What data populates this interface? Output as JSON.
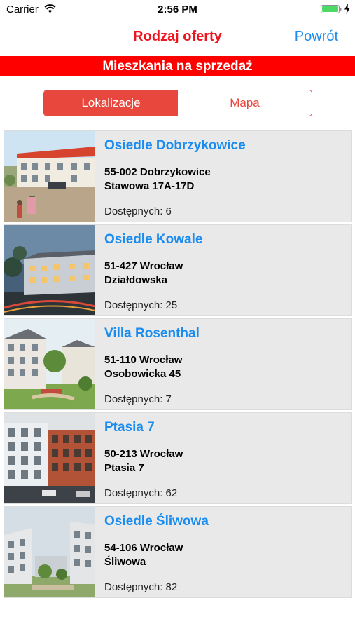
{
  "status_bar": {
    "carrier": "Carrier",
    "time": "2:56 PM",
    "wifi_icon": "wifi-icon",
    "battery_icon": "battery-icon",
    "charging_icon": "charging-bolt-icon",
    "battery_color": "#4cd964"
  },
  "nav": {
    "title": "Rodzaj oferty",
    "back_label": "Powrót",
    "title_color": "#f0141e",
    "link_color": "#1a8cf0"
  },
  "banner": {
    "text": "Mieszkania na sprzedaż",
    "color": "#ff0000"
  },
  "segmented": {
    "options": [
      "Lokalizacje",
      "Mapa"
    ],
    "selected": "Lokalizacje",
    "accent": "#e8473d"
  },
  "listings": [
    {
      "name": "Osiedle Dobrzykowice",
      "address_line1": "55-002 Dobrzykowice",
      "address_line2": "Stawowa 17A-17D",
      "available": "Dostępnych: 6"
    },
    {
      "name": "Osiedle Kowale",
      "address_line1": "51-427 Wrocław",
      "address_line2": "Działdowska",
      "available": "Dostępnych: 25"
    },
    {
      "name": "Villa Rosenthal",
      "address_line1": "51-110 Wrocław",
      "address_line2": "Osobowicka 45",
      "available": "Dostępnych: 7"
    },
    {
      "name": "Ptasia 7",
      "address_line1": "50-213 Wrocław",
      "address_line2": "Ptasia 7",
      "available": "Dostępnych: 62"
    },
    {
      "name": "Osiedle Śliwowa",
      "address_line1": "54-106 Wrocław",
      "address_line2": "Śliwowa",
      "available": "Dostępnych: 82"
    }
  ]
}
